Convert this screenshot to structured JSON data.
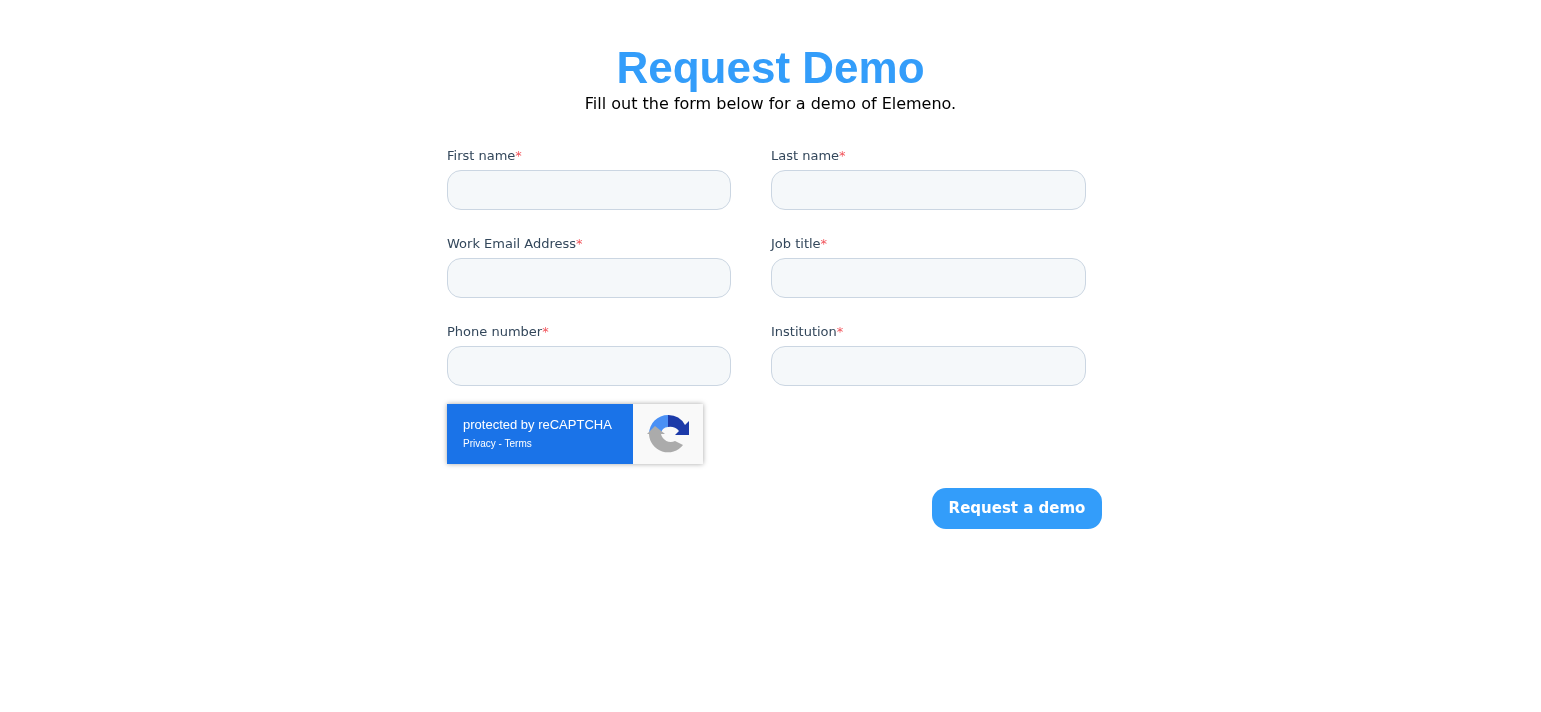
{
  "title": "Request Demo",
  "subtitle": "Fill out the form below for a demo of Elemeno.",
  "fields": [
    {
      "label": "First name",
      "required_mark": "*"
    },
    {
      "label": "Last name",
      "required_mark": "*"
    },
    {
      "label": "Work Email Address",
      "required_mark": "*"
    },
    {
      "label": "Job title",
      "required_mark": "*"
    },
    {
      "label": "Phone number",
      "required_mark": "*"
    },
    {
      "label": "Institution",
      "required_mark": "*"
    }
  ],
  "recaptcha": {
    "text": "protected by reCAPTCHA",
    "links": [
      "Privacy - Terms"
    ]
  },
  "submit": "Request a demo"
}
